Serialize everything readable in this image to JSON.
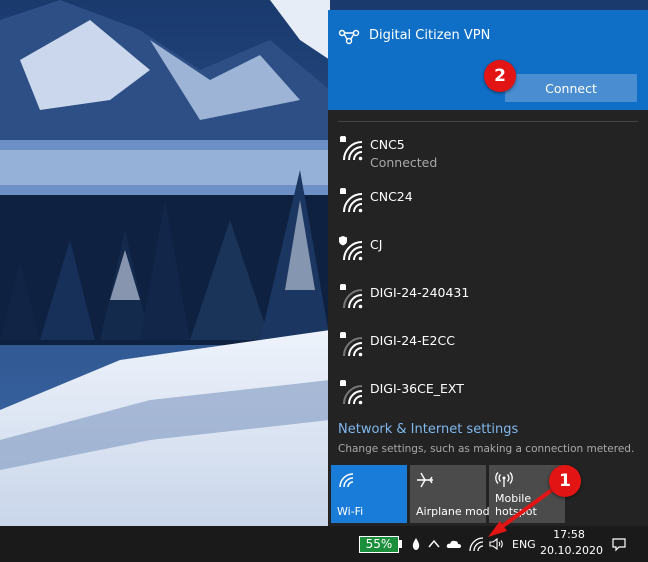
{
  "vpn": {
    "icon": "vpn-icon",
    "name": "Digital Citizen VPN",
    "connect_label": "Connect"
  },
  "networks": [
    {
      "ssid": "CNC5",
      "status": "Connected",
      "secure": true
    },
    {
      "ssid": "CNC24",
      "status": "",
      "secure": true
    },
    {
      "ssid": "CJ",
      "status": "",
      "secure": true
    },
    {
      "ssid": "DIGI-24-240431",
      "status": "",
      "secure": true
    },
    {
      "ssid": "DIGI-24-E2CC",
      "status": "",
      "secure": true
    },
    {
      "ssid": "DIGI-36CE_EXT",
      "status": "",
      "secure": true
    }
  ],
  "settings": {
    "link": "Network & Internet settings",
    "description": "Change settings, such as making a connection metered."
  },
  "quick_actions": [
    {
      "label": "Wi-Fi",
      "icon": "wifi-icon",
      "active": true
    },
    {
      "label": "Airplane mode",
      "icon": "airplane-icon",
      "active": false
    },
    {
      "label": "Mobile hotspot",
      "label_line1": "Mobile",
      "label_line2": "hotspot",
      "icon": "hotspot-icon",
      "active": false
    }
  ],
  "taskbar": {
    "battery_percent": "55%",
    "language": "ENG",
    "time": "17:58",
    "date": "20.10.2020"
  },
  "annotations": {
    "step1": "1",
    "step2": "2"
  },
  "colors": {
    "accent": "#0f6fc6",
    "flyout_bg": "#232323",
    "badge": "#e31414",
    "battery": "#1c8f3c",
    "link": "#7fb8ef"
  }
}
